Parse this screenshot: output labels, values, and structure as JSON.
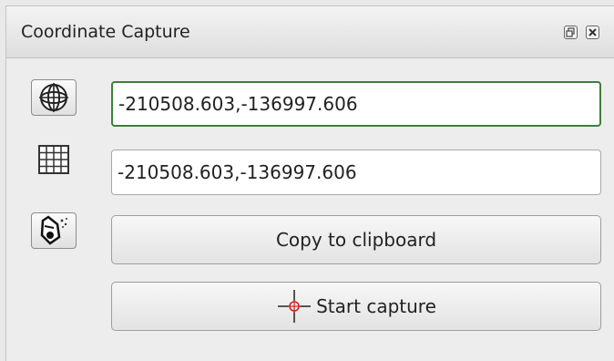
{
  "panel": {
    "title": "Coordinate Capture",
    "float_icon": "float-window-icon",
    "close_icon": "close-icon"
  },
  "rows": {
    "map_crs_icon": "globe-crs-icon",
    "map_coordinate": "-210508.603,-136997.606",
    "canvas_crs_icon": "grid-icon",
    "canvas_coordinate": "-210508.603,-136997.606",
    "tracking_icon": "mouse-tracking-icon"
  },
  "buttons": {
    "copy_label": "Copy to clipboard",
    "start_capture_label": "Start capture",
    "start_capture_icon": "crosshair-icon"
  },
  "colors": {
    "focus_border": "#3e7f3a",
    "crosshair": "#d62020"
  }
}
